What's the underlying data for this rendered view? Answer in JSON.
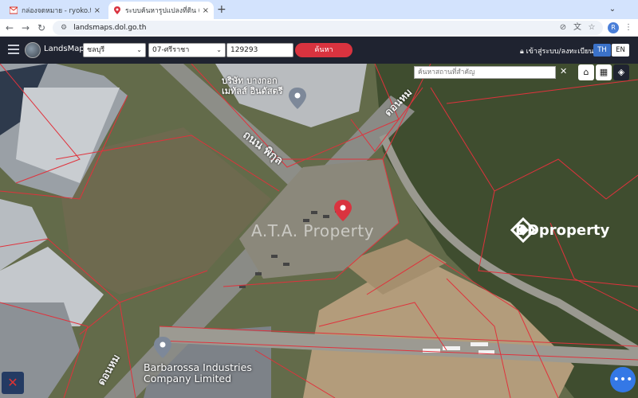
{
  "browser": {
    "tabs": [
      {
        "title": "กล่องจดหมาย - ryoko.transpo..."
      },
      {
        "title": "ระบบค้นหารูปแปลงที่ดิน (LandsM..."
      }
    ],
    "new_tab": "+",
    "url": "landsmaps.dol.go.th",
    "profile_initial": "R"
  },
  "app": {
    "brand": "LandsMaps",
    "province": "ชลบุรี",
    "district": "07-ศรีราชา",
    "parcel_number": "129293",
    "search_button": "ค้นหา",
    "login": "เข้าสู่ระบบ/ลงทะเบียน",
    "lang_th": "TH",
    "lang_en": "EN"
  },
  "map": {
    "search_placeholder": "ค้นหาสถานที่สำคัญ",
    "road_label_1": "ถนน พิกุล",
    "road_label_2": "ดอนหม",
    "road_label_3": "ดอนหม",
    "building_label": "บริษัท บางกอก เมทัลส์ อินดัสตรี",
    "company_name_line1": "Barbarossa Industries",
    "company_name_line2": "Company Limited",
    "watermark_text": "A.T.A. Property",
    "ddproperty_text": "DDproperty"
  },
  "colors": {
    "browser_tab_bg": "#d3e3fd",
    "toolbar_bg": "#1f2330",
    "search_button": "#d9333f",
    "lang_active": "#3b72c9",
    "parcel_lines": "#e0323c",
    "fab_blue": "#3478e6"
  }
}
